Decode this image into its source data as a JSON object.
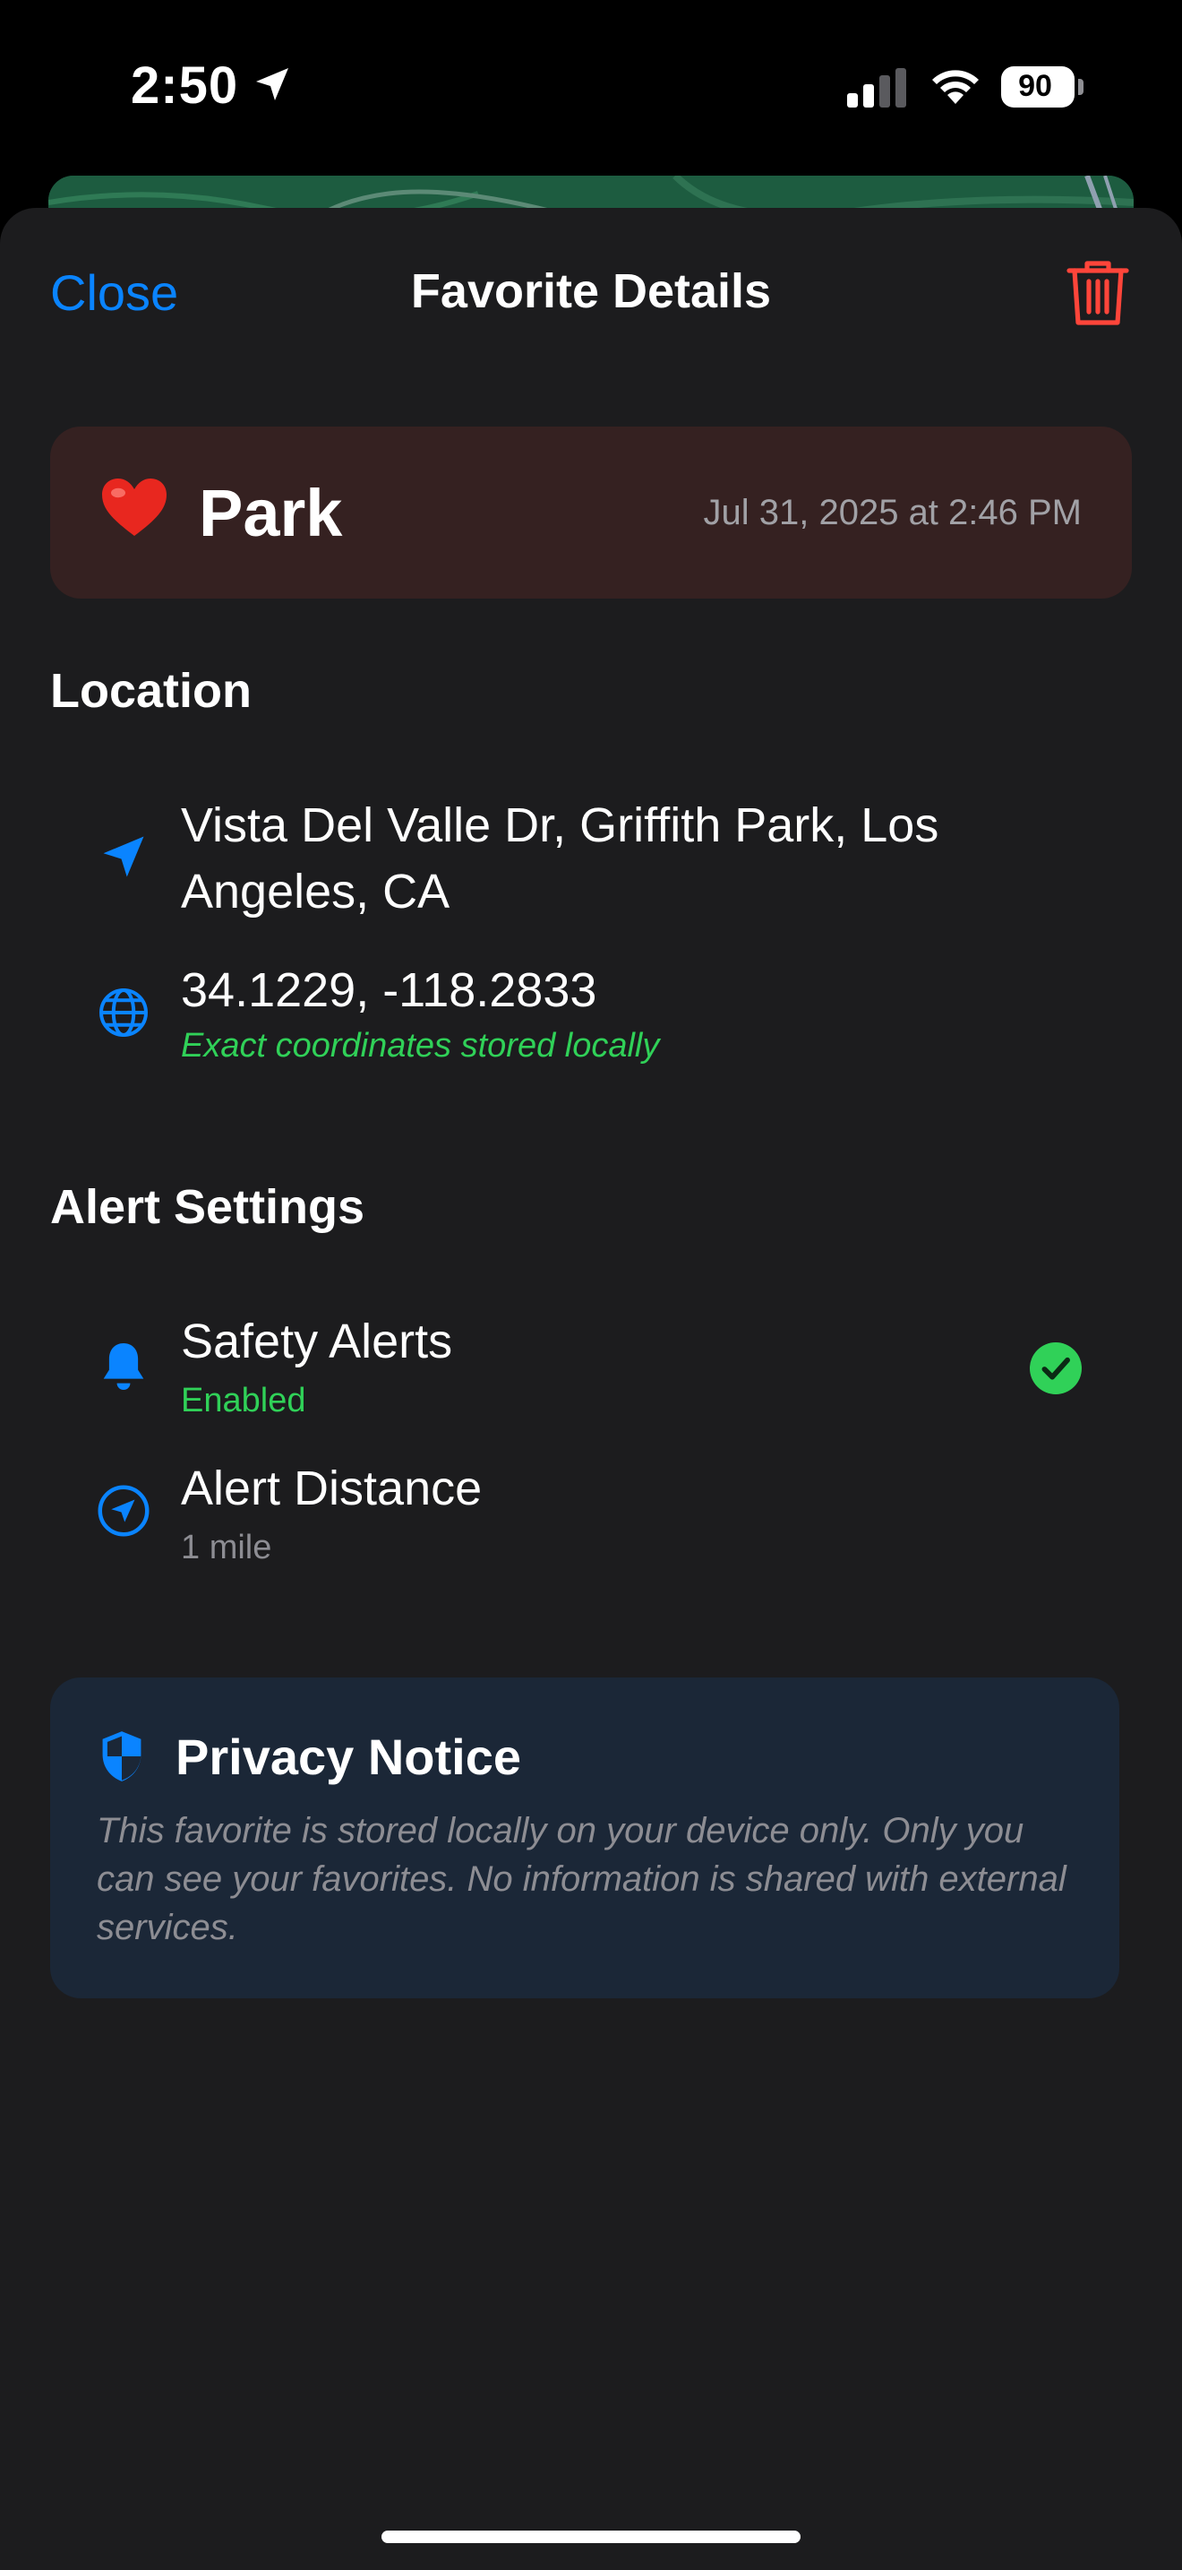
{
  "status_bar": {
    "time": "2:50",
    "battery": "90"
  },
  "nav": {
    "close_label": "Close",
    "title": "Favorite Details"
  },
  "favorite": {
    "emoji": "❤️",
    "name": "Park",
    "date": "Jul 31, 2025 at 2:46 PM"
  },
  "location": {
    "section_title": "Location",
    "address_line1": "Vista Del Valle Dr, Griffith Park, Los",
    "address_line2": "Angeles, CA",
    "coordinates": "34.1229, -118.2833",
    "coordinates_note": "Exact coordinates stored locally"
  },
  "alerts": {
    "section_title": "Alert Settings",
    "safety_label": "Safety Alerts",
    "safety_status": "Enabled",
    "distance_label": "Alert Distance",
    "distance_value": "1 mile"
  },
  "privacy": {
    "title": "Privacy Notice",
    "body": "This favorite is stored locally on your device only. Only you can see your favorites. No information is shared with external services."
  },
  "colors": {
    "accent_blue": "#0a84ff",
    "destructive_red": "#ff453a",
    "success_green": "#30d158",
    "sheet_background": "#1c1c1e"
  },
  "icons": [
    "location-arrow-icon",
    "cellular-signal-icon",
    "wifi-icon",
    "battery-icon",
    "trash-icon",
    "navigation-arrow-icon",
    "globe-icon",
    "bell-icon",
    "compass-location-icon",
    "checkmark-circle-icon",
    "shield-icon"
  ]
}
